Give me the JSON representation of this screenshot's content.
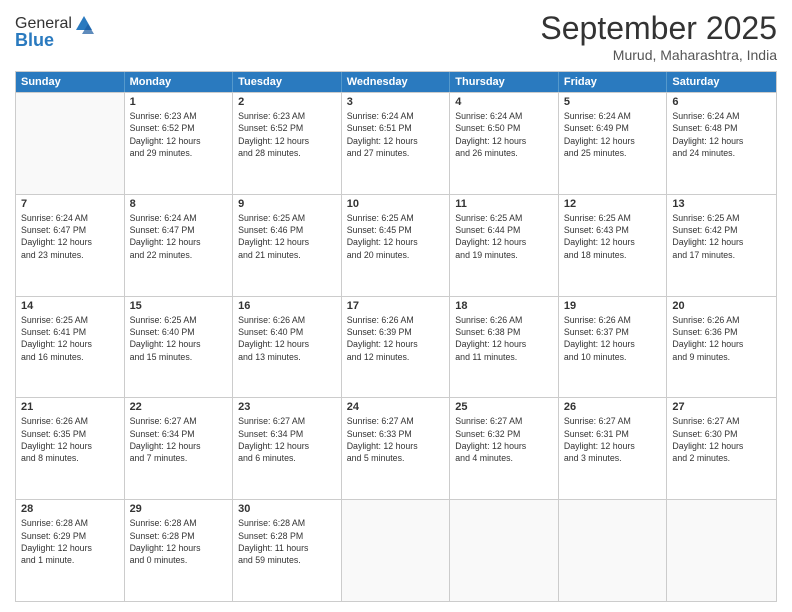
{
  "header": {
    "logo_general": "General",
    "logo_blue": "Blue",
    "month_title": "September 2025",
    "location": "Murud, Maharashtra, India"
  },
  "weekdays": [
    "Sunday",
    "Monday",
    "Tuesday",
    "Wednesday",
    "Thursday",
    "Friday",
    "Saturday"
  ],
  "rows": [
    [
      {
        "day": "",
        "empty": true
      },
      {
        "day": "1",
        "info": "Sunrise: 6:23 AM\nSunset: 6:52 PM\nDaylight: 12 hours\nand 29 minutes."
      },
      {
        "day": "2",
        "info": "Sunrise: 6:23 AM\nSunset: 6:52 PM\nDaylight: 12 hours\nand 28 minutes."
      },
      {
        "day": "3",
        "info": "Sunrise: 6:24 AM\nSunset: 6:51 PM\nDaylight: 12 hours\nand 27 minutes."
      },
      {
        "day": "4",
        "info": "Sunrise: 6:24 AM\nSunset: 6:50 PM\nDaylight: 12 hours\nand 26 minutes."
      },
      {
        "day": "5",
        "info": "Sunrise: 6:24 AM\nSunset: 6:49 PM\nDaylight: 12 hours\nand 25 minutes."
      },
      {
        "day": "6",
        "info": "Sunrise: 6:24 AM\nSunset: 6:48 PM\nDaylight: 12 hours\nand 24 minutes."
      }
    ],
    [
      {
        "day": "7",
        "info": "Sunrise: 6:24 AM\nSunset: 6:47 PM\nDaylight: 12 hours\nand 23 minutes."
      },
      {
        "day": "8",
        "info": "Sunrise: 6:24 AM\nSunset: 6:47 PM\nDaylight: 12 hours\nand 22 minutes."
      },
      {
        "day": "9",
        "info": "Sunrise: 6:25 AM\nSunset: 6:46 PM\nDaylight: 12 hours\nand 21 minutes."
      },
      {
        "day": "10",
        "info": "Sunrise: 6:25 AM\nSunset: 6:45 PM\nDaylight: 12 hours\nand 20 minutes."
      },
      {
        "day": "11",
        "info": "Sunrise: 6:25 AM\nSunset: 6:44 PM\nDaylight: 12 hours\nand 19 minutes."
      },
      {
        "day": "12",
        "info": "Sunrise: 6:25 AM\nSunset: 6:43 PM\nDaylight: 12 hours\nand 18 minutes."
      },
      {
        "day": "13",
        "info": "Sunrise: 6:25 AM\nSunset: 6:42 PM\nDaylight: 12 hours\nand 17 minutes."
      }
    ],
    [
      {
        "day": "14",
        "info": "Sunrise: 6:25 AM\nSunset: 6:41 PM\nDaylight: 12 hours\nand 16 minutes."
      },
      {
        "day": "15",
        "info": "Sunrise: 6:25 AM\nSunset: 6:40 PM\nDaylight: 12 hours\nand 15 minutes."
      },
      {
        "day": "16",
        "info": "Sunrise: 6:26 AM\nSunset: 6:40 PM\nDaylight: 12 hours\nand 13 minutes."
      },
      {
        "day": "17",
        "info": "Sunrise: 6:26 AM\nSunset: 6:39 PM\nDaylight: 12 hours\nand 12 minutes."
      },
      {
        "day": "18",
        "info": "Sunrise: 6:26 AM\nSunset: 6:38 PM\nDaylight: 12 hours\nand 11 minutes."
      },
      {
        "day": "19",
        "info": "Sunrise: 6:26 AM\nSunset: 6:37 PM\nDaylight: 12 hours\nand 10 minutes."
      },
      {
        "day": "20",
        "info": "Sunrise: 6:26 AM\nSunset: 6:36 PM\nDaylight: 12 hours\nand 9 minutes."
      }
    ],
    [
      {
        "day": "21",
        "info": "Sunrise: 6:26 AM\nSunset: 6:35 PM\nDaylight: 12 hours\nand 8 minutes."
      },
      {
        "day": "22",
        "info": "Sunrise: 6:27 AM\nSunset: 6:34 PM\nDaylight: 12 hours\nand 7 minutes."
      },
      {
        "day": "23",
        "info": "Sunrise: 6:27 AM\nSunset: 6:34 PM\nDaylight: 12 hours\nand 6 minutes."
      },
      {
        "day": "24",
        "info": "Sunrise: 6:27 AM\nSunset: 6:33 PM\nDaylight: 12 hours\nand 5 minutes."
      },
      {
        "day": "25",
        "info": "Sunrise: 6:27 AM\nSunset: 6:32 PM\nDaylight: 12 hours\nand 4 minutes."
      },
      {
        "day": "26",
        "info": "Sunrise: 6:27 AM\nSunset: 6:31 PM\nDaylight: 12 hours\nand 3 minutes."
      },
      {
        "day": "27",
        "info": "Sunrise: 6:27 AM\nSunset: 6:30 PM\nDaylight: 12 hours\nand 2 minutes."
      }
    ],
    [
      {
        "day": "28",
        "info": "Sunrise: 6:28 AM\nSunset: 6:29 PM\nDaylight: 12 hours\nand 1 minute."
      },
      {
        "day": "29",
        "info": "Sunrise: 6:28 AM\nSunset: 6:28 PM\nDaylight: 12 hours\nand 0 minutes."
      },
      {
        "day": "30",
        "info": "Sunrise: 6:28 AM\nSunset: 6:28 PM\nDaylight: 11 hours\nand 59 minutes."
      },
      {
        "day": "",
        "empty": true
      },
      {
        "day": "",
        "empty": true
      },
      {
        "day": "",
        "empty": true
      },
      {
        "day": "",
        "empty": true
      }
    ]
  ]
}
